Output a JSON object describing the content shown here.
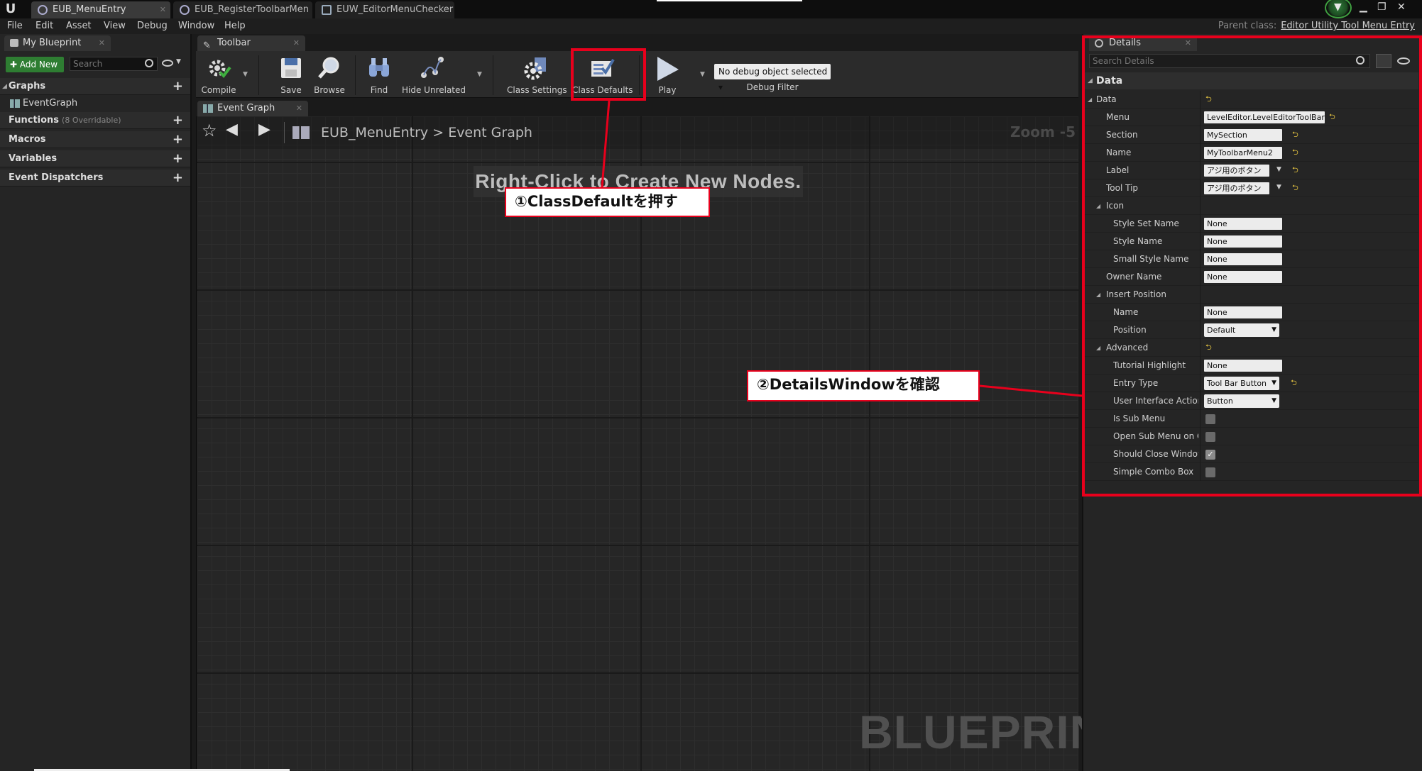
{
  "tabs": [
    {
      "label": "EUB_MenuEntry",
      "active": true
    },
    {
      "label": "EUB_RegisterToolbarMen",
      "active": false
    },
    {
      "label": "EUW_EditorMenuChecker",
      "active": false
    }
  ],
  "menu": [
    "File",
    "Edit",
    "Asset",
    "View",
    "Debug",
    "Window",
    "Help"
  ],
  "parent_class": {
    "prefix": "Parent class:",
    "value": "Editor Utility Tool Menu Entry"
  },
  "left_panel": {
    "tab": "My Blueprint",
    "add_new": "Add New",
    "search_placeholder": "Search",
    "sections": {
      "graphs": "Graphs",
      "functions": "Functions",
      "functions_sub": "(8 Overridable)",
      "macros": "Macros",
      "variables": "Variables",
      "dispatchers": "Event Dispatchers"
    },
    "graph_item": "EventGraph"
  },
  "toolbar": {
    "tab": "Toolbar",
    "compile": "Compile",
    "save": "Save",
    "browse": "Browse",
    "find": "Find",
    "hide_unrelated": "Hide Unrelated",
    "class_settings": "Class Settings",
    "class_defaults": "Class Defaults",
    "play": "Play",
    "debug_select": "No debug object selected",
    "debug_filter": "Debug Filter"
  },
  "graph": {
    "tab": "Event Graph",
    "breadcrumb_root": "EUB_MenuEntry",
    "breadcrumb_sep": ">",
    "breadcrumb_leaf": "Event Graph",
    "zoom": "Zoom -5",
    "hint": "Right-Click to Create New Nodes.",
    "watermark": "BLUEPRINT"
  },
  "details": {
    "tab": "Details",
    "search_placeholder": "Search Details",
    "category": "Data",
    "rows": {
      "data": "Data",
      "menu": {
        "label": "Menu",
        "value": "LevelEditor.LevelEditorToolBar"
      },
      "section": {
        "label": "Section",
        "value": "MySection"
      },
      "name": {
        "label": "Name",
        "value": "MyToolbarMenu2"
      },
      "label": {
        "label": "Label",
        "value": "アジ用のボタン"
      },
      "tooltip": {
        "label": "Tool Tip",
        "value": "アジ用のボタン"
      },
      "icon": "Icon",
      "style_set": {
        "label": "Style Set Name",
        "value": "None"
      },
      "style_name": {
        "label": "Style Name",
        "value": "None"
      },
      "small_style": {
        "label": "Small Style Name",
        "value": "None"
      },
      "owner": {
        "label": "Owner Name",
        "value": "None"
      },
      "insert_position": "Insert Position",
      "ip_name": {
        "label": "Name",
        "value": "None"
      },
      "ip_position": {
        "label": "Position",
        "value": "Default"
      },
      "advanced": "Advanced",
      "tutorial": {
        "label": "Tutorial Highlight",
        "value": "None"
      },
      "entry_type": {
        "label": "Entry Type",
        "value": "Tool Bar Button"
      },
      "ui_action": {
        "label": "User Interface Action T",
        "value": "Button"
      },
      "is_sub_menu": {
        "label": "Is Sub Menu",
        "checked": false
      },
      "open_sub_menu": {
        "label": "Open Sub Menu on Clic",
        "checked": false
      },
      "should_close": {
        "label": "Should Close Window A",
        "checked": true
      },
      "simple_combo": {
        "label": "Simple Combo Box",
        "checked": false
      }
    }
  },
  "annotations": {
    "callout1": "①ClassDefaultを押す",
    "callout2": "②DetailsWindowを確認",
    "color": "#e8001c"
  },
  "colors": {
    "accent_green": "#2e7d32",
    "reset_arrow": "#e0c040"
  }
}
